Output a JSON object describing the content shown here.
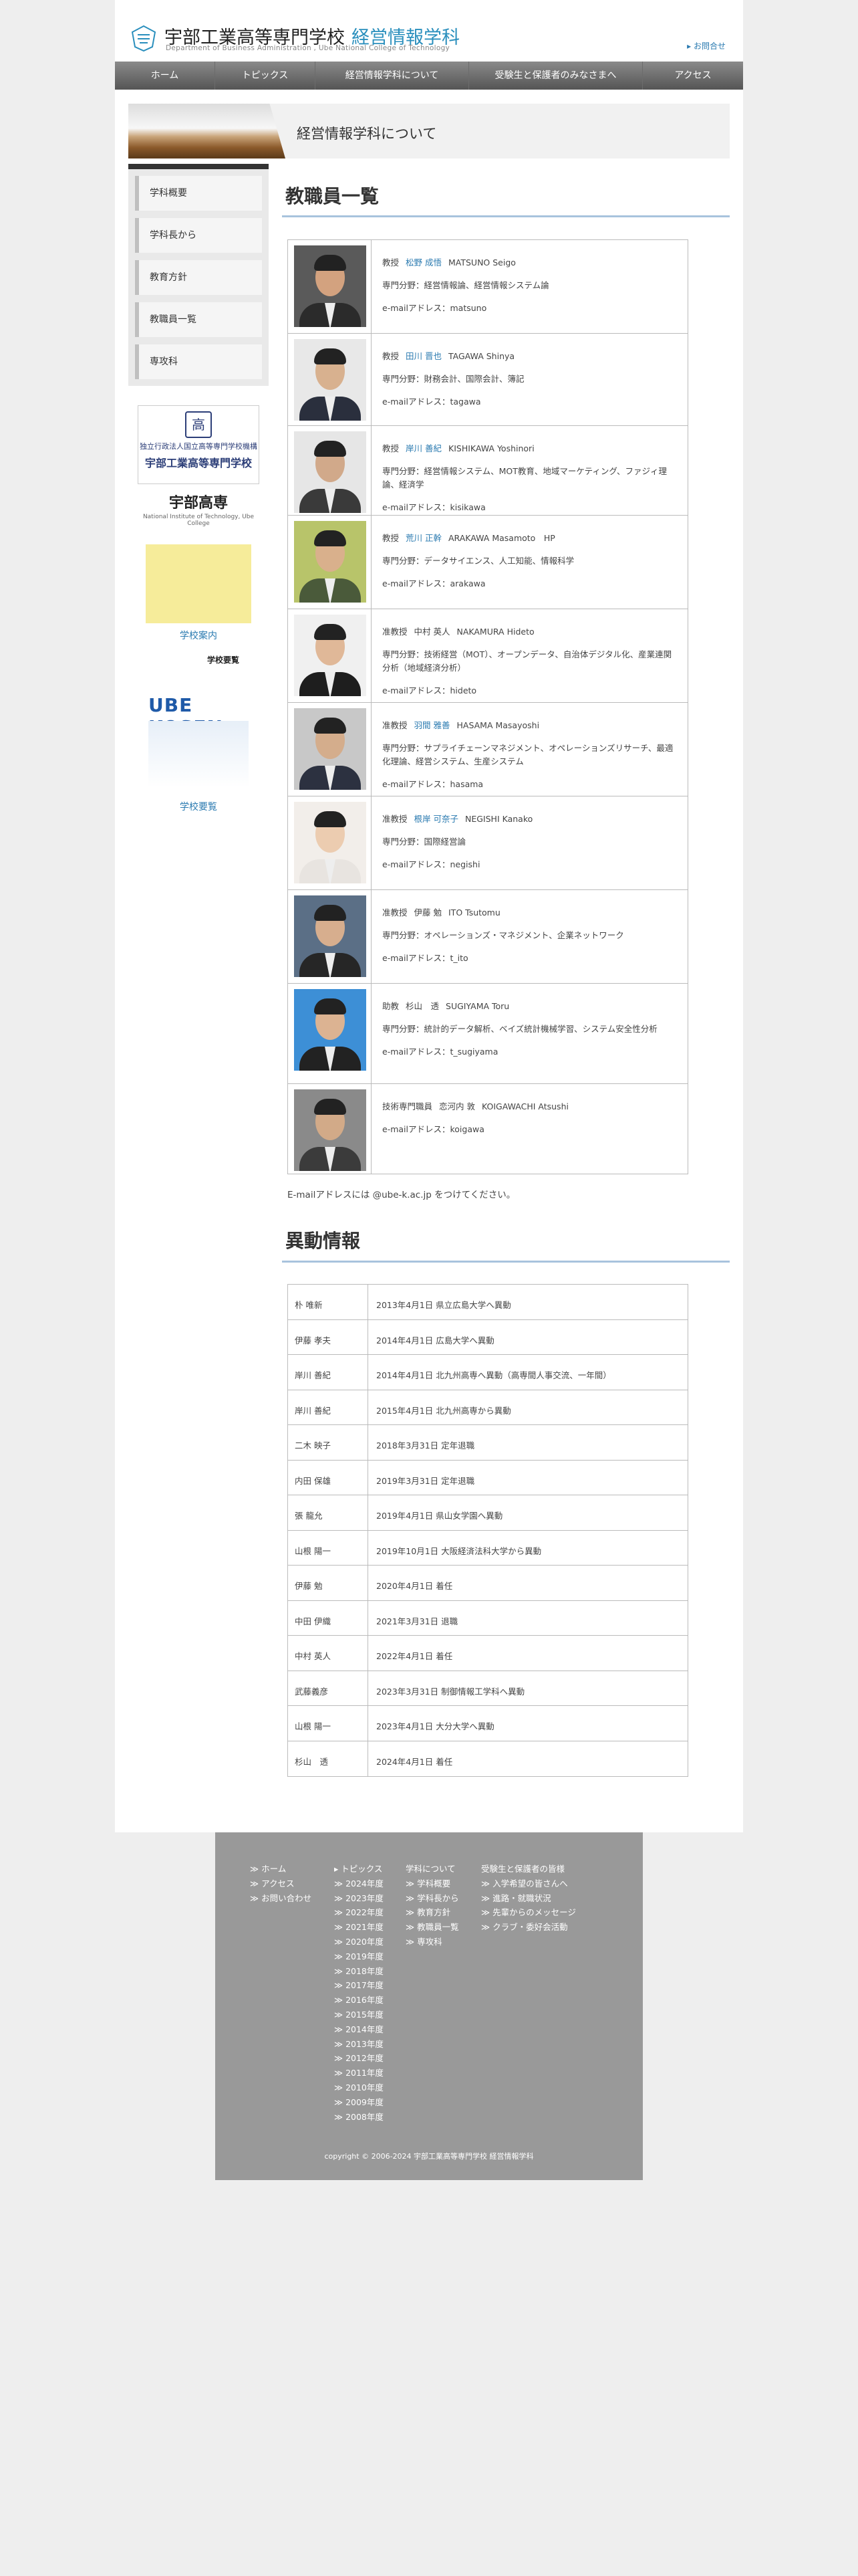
{
  "header": {
    "title": "宇部工業高等専門学校",
    "dept": "経営情報学科",
    "subtitle": "Department of Business Administration , Ube National College of Technology",
    "contact": "お問合せ"
  },
  "nav": [
    "ホーム",
    "トピックス",
    "経営情報学科について",
    "受験生と保護者のみなさまへ",
    "アクセス"
  ],
  "banner": {
    "title": "経営情報学科について"
  },
  "sidebar": {
    "items": [
      "学科概要",
      "学科長から",
      "教育方針",
      "教職員一覧",
      "専攻科"
    ],
    "banner1": {
      "line1": "独立行政法人国立高等専門学校機構",
      "line2": "宇部工業高等専門学校"
    },
    "brochure": {
      "title": "宇部高専",
      "sub": "National Institute of Technology, Ube College",
      "link": "学校案内"
    },
    "ube": {
      "label": "学校要覧",
      "logo": "UBE KOSEN",
      "link": "学校要覧"
    }
  },
  "staff_heading": "教職員一覧",
  "staff": [
    {
      "title": "教授",
      "name_jp": "松野 成悟",
      "name_en": "MATSUNO Seigo",
      "linked": true,
      "field": "専門分野：経営情報論、経営情報システム論",
      "email": "e-mailアドレス：matsuno",
      "bg": "#5a5a5a",
      "skin": "#d3a27f",
      "suit": "#2b2b2b"
    },
    {
      "title": "教授",
      "name_jp": "田川 晋也",
      "name_en": "TAGAWA Shinya",
      "linked": true,
      "field": "専門分野：財務会計、国際会計、簿記",
      "email": "e-mailアドレス：tagawa",
      "bg": "#e8e8e8",
      "skin": "#d8b18f",
      "suit": "#2a2f3d"
    },
    {
      "title": "教授",
      "name_jp": "岸川 善紀",
      "name_en": "KISHIKAWA Yoshinori",
      "linked": true,
      "field": "専門分野：経営情報システム、MOT教育、地域マーケティング、ファジィ理論、経済学",
      "email": "e-mailアドレス：kisikawa",
      "bg": "#e6e6e6",
      "skin": "#d1a98a",
      "suit": "#3a3a3a"
    },
    {
      "title": "教授",
      "name_jp": "荒川 正幹",
      "name_en": "ARAKAWA Masamoto　HP",
      "linked": true,
      "field": "専門分野：データサイエンス、人工知能、情報科学",
      "email": "e-mailアドレス：arakawa",
      "bg": "#b8c46a",
      "skin": "#d9b08c",
      "suit": "#4a5a3a"
    },
    {
      "title": "准教授",
      "name_jp": "中村 英人",
      "name_en": "NAKAMURA Hideto",
      "linked": false,
      "field": "専門分野：技術経営（MOT）、オープンデータ、自治体デジタル化、産業連関分析（地域経済分析）",
      "email": "e-mailアドレス：hideto",
      "bg": "#f0f0f0",
      "skin": "#e0b898",
      "suit": "#1e1e1e"
    },
    {
      "title": "准教授",
      "name_jp": "羽間 雅善",
      "name_en": "HASAMA Masayoshi",
      "linked": true,
      "field": "専門分野：サプライチェーンマネジメント、オペレーションズリサーチ、最適化理論、経営システム、生産システム",
      "email": "e-mailアドレス：hasama",
      "bg": "#c8c8c8",
      "skin": "#d4ad8c",
      "suit": "#2c3140"
    },
    {
      "title": "准教授",
      "name_jp": "根岸 可奈子",
      "name_en": "NEGISHI Kanako",
      "linked": true,
      "field": "専門分野：国際経営論",
      "email": "e-mailアドレス：negishi",
      "bg": "#f2eeea",
      "skin": "#ecccb0",
      "suit": "#e8e4e0"
    },
    {
      "title": "准教授",
      "name_jp": "伊藤 勉",
      "name_en": "ITO Tsutomu",
      "linked": false,
      "field": "専門分野：オペレーションズ・マネジメント、企業ネットワーク",
      "email": "e-mailアドレス：t_ito",
      "bg": "#5b6f86",
      "skin": "#d7ae8e",
      "suit": "#262626"
    },
    {
      "title": "助教",
      "name_jp": "杉山　透",
      "name_en": "SUGIYAMA Toru",
      "linked": false,
      "field": "専門分野：統計的データ解析、ベイズ統計機械学習、システム安全性分析",
      "email": "e-mailアドレス：t_sugiyama",
      "bg": "#3d8fd6",
      "skin": "#dcb392",
      "suit": "#222"
    },
    {
      "title": "技術専門職員",
      "name_jp": "恋河内 敦",
      "name_en": "KOIGAWACHI Atsushi",
      "linked": false,
      "field": "",
      "email": "e-mailアドレス：koigawa",
      "bg": "#8a8a8a",
      "skin": "#d2aa88",
      "suit": "#3b3b3b"
    }
  ],
  "email_note": "E-mailアドレスには @ube-k.ac.jp をつけてください。",
  "moves_heading": "異動情報",
  "moves": [
    {
      "name": "朴 唯新",
      "desc": "2013年4月1日 県立広島大学へ異動"
    },
    {
      "name": "伊藤 孝夫",
      "desc": "2014年4月1日 広島大学へ異動"
    },
    {
      "name": "岸川 善紀",
      "desc": "2014年4月1日 北九州高専へ異動（高専間人事交流、一年間）"
    },
    {
      "name": "岸川 善紀",
      "desc": "2015年4月1日 北九州高専から異動"
    },
    {
      "name": "二木 映子",
      "desc": "2018年3月31日 定年退職"
    },
    {
      "name": "内田 保雄",
      "desc": "2019年3月31日 定年退職"
    },
    {
      "name": "張 龍允",
      "desc": "2019年4月1日 県山女学園へ異動"
    },
    {
      "name": "山根 陽一",
      "desc": "2019年10月1日 大阪経済法科大学から異動"
    },
    {
      "name": "伊藤 勉",
      "desc": "2020年4月1日 着任"
    },
    {
      "name": "中田 伊織",
      "desc": "2021年3月31日 退職"
    },
    {
      "name": "中村 英人",
      "desc": "2022年4月1日 着任"
    },
    {
      "name": "武藤義彦",
      "desc": "2023年3月31日 制御情報工学科へ異動"
    },
    {
      "name": "山根 陽一",
      "desc": "2023年4月1日 大分大学へ異動"
    },
    {
      "name": "杉山　透",
      "desc": "2024年4月1日 着任"
    }
  ],
  "footer": {
    "col1": [
      "ホーム",
      "アクセス",
      "お問い合わせ"
    ],
    "col2_head": "トピックス",
    "col2": [
      "2024年度",
      "2023年度",
      "2022年度",
      "2021年度",
      "2020年度",
      "2019年度",
      "2018年度",
      "2017年度",
      "2016年度",
      "2015年度",
      "2014年度",
      "2013年度",
      "2012年度",
      "2011年度",
      "2010年度",
      "2009年度",
      "2008年度"
    ],
    "col3_head": "学科について",
    "col3": [
      "学科概要",
      "学科長から",
      "教育方針",
      "教職員一覧",
      "専攻科"
    ],
    "col4_head": "受験生と保護者の皆様",
    "col4": [
      "入学希望の皆さんへ",
      "進路・就職状況",
      "先輩からのメッセージ",
      "クラブ・委好会活動"
    ],
    "copyright": "copyright © 2006-2024 宇部工業高等専門学校 経営情報学科"
  }
}
